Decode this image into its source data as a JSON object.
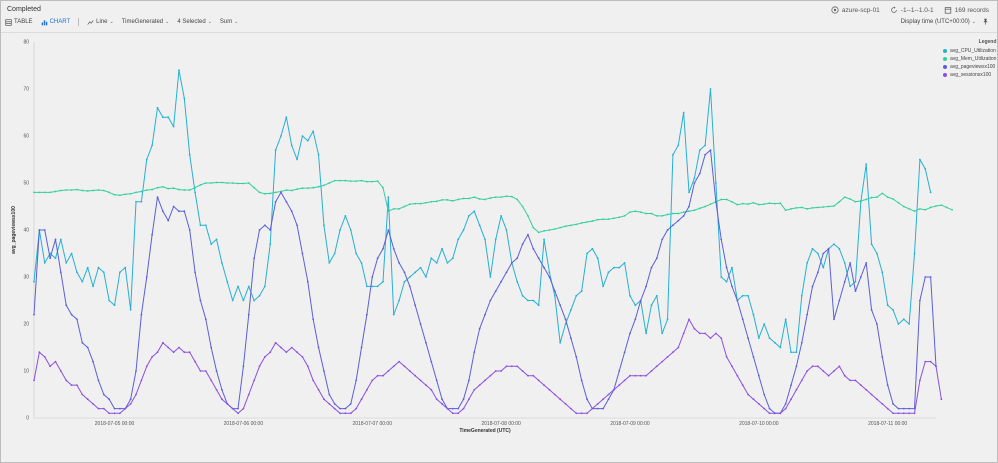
{
  "status": "Completed",
  "header": {
    "workspace": "azure-scp-01",
    "time_range": "-1--1--1.0-1",
    "records": "169 records"
  },
  "toolbar": {
    "table_label": "TABLE",
    "chart_label": "CHART",
    "line_label": "Line",
    "x_field": "TimeGenerated",
    "selected": "4 Selected",
    "agg": "Sum",
    "display_time": "Display time (UTC+00:00)"
  },
  "colors": {
    "cpu": "#26b0d3",
    "mem": "#33cf9b",
    "pageviews": "#5a5fd8",
    "sessions": "#8c4fe0",
    "accent": "#1f6fd1"
  },
  "legend_title": "Legend",
  "chart_data": {
    "type": "line",
    "xlabel": "TimeGenerated (UTC)",
    "ylabel": "avg_pageviewsx100",
    "ylim": [
      0,
      80
    ],
    "yticks": [
      0,
      10,
      20,
      30,
      40,
      50,
      60,
      70,
      80
    ],
    "xlim": [
      0,
      168
    ],
    "xtick_positions": [
      15,
      39,
      63,
      87,
      111,
      135,
      159
    ],
    "xtick_labels": [
      "2018-07-05 00:00",
      "2018-07-06 00:00",
      "2018-07-07 00:00",
      "2018-07-08 00:00",
      "2018-07-09 00:00",
      "2018-07-10 00:00",
      "2018-07-11 00:00"
    ],
    "series": [
      {
        "name": "avg_CPU_Utilization",
        "color": "#26b0d3",
        "values": [
          29,
          40,
          33,
          35,
          34,
          38,
          33,
          35,
          31,
          29,
          32,
          28,
          32,
          31,
          25,
          24,
          31,
          32,
          23,
          46,
          46,
          55,
          58,
          66,
          64,
          64,
          62,
          74,
          68,
          56,
          48,
          41,
          41,
          37,
          38,
          33,
          29,
          25,
          28,
          25,
          28,
          25,
          26,
          28,
          37,
          57,
          60,
          64,
          58,
          55,
          60,
          59,
          61,
          56,
          41,
          33,
          35,
          40,
          43,
          40,
          35,
          33,
          28,
          28,
          28,
          29,
          47,
          22,
          25,
          29,
          30,
          31,
          32,
          30,
          34,
          33,
          36,
          33,
          34,
          38,
          40,
          43,
          44,
          41,
          38,
          30,
          38,
          43,
          40,
          33,
          29,
          26,
          25,
          25,
          24,
          38,
          31,
          26,
          16,
          20,
          23,
          26,
          27,
          35,
          36,
          34,
          28,
          31,
          32,
          32,
          33,
          26,
          24,
          25,
          18,
          24,
          26,
          18,
          21,
          56,
          58,
          65,
          48,
          51,
          57,
          58,
          70,
          50,
          30,
          29,
          32,
          25,
          26,
          26,
          22,
          17,
          20,
          17,
          16,
          15,
          21,
          14,
          14,
          26,
          33,
          36,
          35,
          32,
          36,
          37,
          36,
          33,
          28,
          29,
          46,
          54,
          37,
          35,
          31,
          24,
          23,
          20,
          21,
          20,
          35,
          55,
          53,
          48
        ]
      },
      {
        "name": "avg_Mem_Utilization",
        "color": "#33cf9b",
        "values": [
          48,
          48,
          48,
          48,
          48.2,
          48.4,
          48.5,
          48.5,
          48.6,
          48.4,
          48.3,
          48.4,
          48.5,
          48.4,
          48,
          47.5,
          47.4,
          47.6,
          47.7,
          48,
          48.2,
          48.5,
          48.6,
          49,
          49.2,
          48.8,
          48.9,
          48.6,
          48.5,
          48.5,
          49,
          49.6,
          50,
          50,
          50.1,
          50.1,
          50,
          50,
          49.9,
          49.9,
          50,
          49,
          48,
          47.7,
          47.8,
          48,
          48.2,
          48.5,
          48.4,
          48.7,
          48.9,
          48.9,
          49,
          49.2,
          49.5,
          50,
          50.5,
          50.5,
          50.5,
          50.4,
          50.4,
          50.5,
          50.3,
          50.3,
          50.4,
          49,
          44,
          44.5,
          44.5,
          45,
          45.5,
          45.6,
          45.6,
          45.8,
          46,
          46.1,
          46.4,
          46.4,
          46.2,
          46.5,
          46.7,
          46.7,
          47,
          46.6,
          46.5,
          46.8,
          47,
          47,
          47.2,
          47.1,
          46.5,
          45,
          43,
          40.5,
          39.5,
          39.8,
          40,
          40.2,
          40.5,
          40.8,
          41,
          41.2,
          41.5,
          41.7,
          41.9,
          42.2,
          42.3,
          42.3,
          42.5,
          42.7,
          43,
          43.8,
          44,
          43.8,
          43.5,
          43.5,
          43,
          43,
          43.3,
          43.5,
          43.5,
          43.8,
          44,
          44.2,
          44.6,
          45,
          45.5,
          46,
          46.5,
          46.5,
          46,
          45.4,
          45.6,
          45.5,
          45.8,
          45.4,
          45.5,
          45.7,
          45.6,
          45.7,
          44.2,
          44.5,
          44.7,
          44.8,
          44.5,
          44.7,
          44.8,
          44.9,
          45,
          45.1,
          46,
          47,
          46.6,
          46,
          46.2,
          46.5,
          46.9,
          47,
          47.8,
          47,
          46.6,
          45.8,
          45,
          44.5,
          44,
          44.5,
          44.3,
          44.8,
          45.1,
          45.3,
          44.8,
          44.3
        ]
      },
      {
        "name": "avg_pageviewsx100",
        "color": "#5a5fd8",
        "values": [
          22,
          40,
          40,
          34,
          38,
          31,
          24,
          22,
          21,
          16,
          15,
          12,
          8,
          5,
          4,
          2,
          2,
          2,
          4,
          10,
          22,
          30,
          39,
          47,
          44,
          42,
          45,
          44,
          44,
          40,
          31,
          25,
          21,
          15,
          10,
          6,
          3,
          2,
          2,
          11,
          22,
          34,
          40,
          41,
          40,
          46,
          48,
          46,
          44,
          41,
          35,
          29,
          21,
          15,
          10,
          5,
          3,
          2,
          2,
          3,
          8,
          15,
          22,
          30,
          34,
          36,
          40,
          36,
          33,
          31,
          28,
          24,
          20,
          16,
          12,
          8,
          4,
          2,
          2,
          2,
          4,
          8,
          14,
          19,
          22,
          25,
          27,
          29,
          31,
          33,
          34,
          37,
          39,
          36,
          34,
          32,
          30,
          27,
          24,
          21,
          17,
          13,
          8,
          4,
          2,
          2,
          2,
          4,
          6,
          10,
          14,
          18,
          21,
          25,
          28,
          32,
          34,
          38,
          40,
          41,
          42,
          43,
          45,
          50,
          52,
          56,
          57,
          46,
          38,
          32,
          28,
          25,
          21,
          17,
          13,
          9,
          5,
          2,
          1,
          1,
          3,
          7,
          11,
          16,
          22,
          28,
          31,
          35,
          36,
          21,
          25,
          29,
          33,
          27,
          30,
          33,
          23,
          20,
          13,
          7,
          3,
          2,
          2,
          2,
          2,
          25,
          30,
          30,
          11
        ]
      },
      {
        "name": "avg_sessionsx100",
        "color": "#8c4fe0",
        "values": [
          8,
          14,
          13,
          11,
          12,
          10,
          8,
          7,
          7,
          5,
          4,
          3,
          2,
          2,
          1,
          1,
          1,
          2,
          3,
          5,
          8,
          11,
          13,
          14,
          16,
          15,
          14,
          15,
          14,
          14,
          12,
          10,
          10,
          8,
          6,
          4,
          3,
          2,
          1,
          2,
          5,
          8,
          11,
          13,
          14,
          16,
          15,
          14,
          15,
          14,
          13,
          11,
          8,
          6,
          4,
          3,
          2,
          1,
          1,
          1,
          2,
          4,
          6,
          8,
          9,
          9,
          10,
          11,
          12,
          11,
          10,
          9,
          8,
          7,
          6,
          4,
          3,
          2,
          1,
          1,
          2,
          4,
          6,
          7,
          8,
          9,
          10,
          10,
          11,
          11,
          11,
          10,
          9,
          9,
          8,
          7,
          6,
          5,
          4,
          3,
          2,
          1,
          1,
          1,
          2,
          3,
          4,
          5,
          6,
          7,
          8,
          9,
          9,
          9,
          9,
          10,
          11,
          12,
          13,
          14,
          15,
          18,
          21,
          19,
          18,
          18,
          17,
          18,
          17,
          13,
          11,
          9,
          7,
          5,
          4,
          3,
          2,
          1,
          1,
          1,
          2,
          4,
          6,
          8,
          10,
          11,
          11,
          10,
          9,
          10,
          11,
          9,
          8,
          8,
          7,
          6,
          5,
          4,
          3,
          2,
          1,
          1,
          1,
          1,
          1,
          8,
          12,
          12,
          11,
          4
        ]
      }
    ]
  }
}
